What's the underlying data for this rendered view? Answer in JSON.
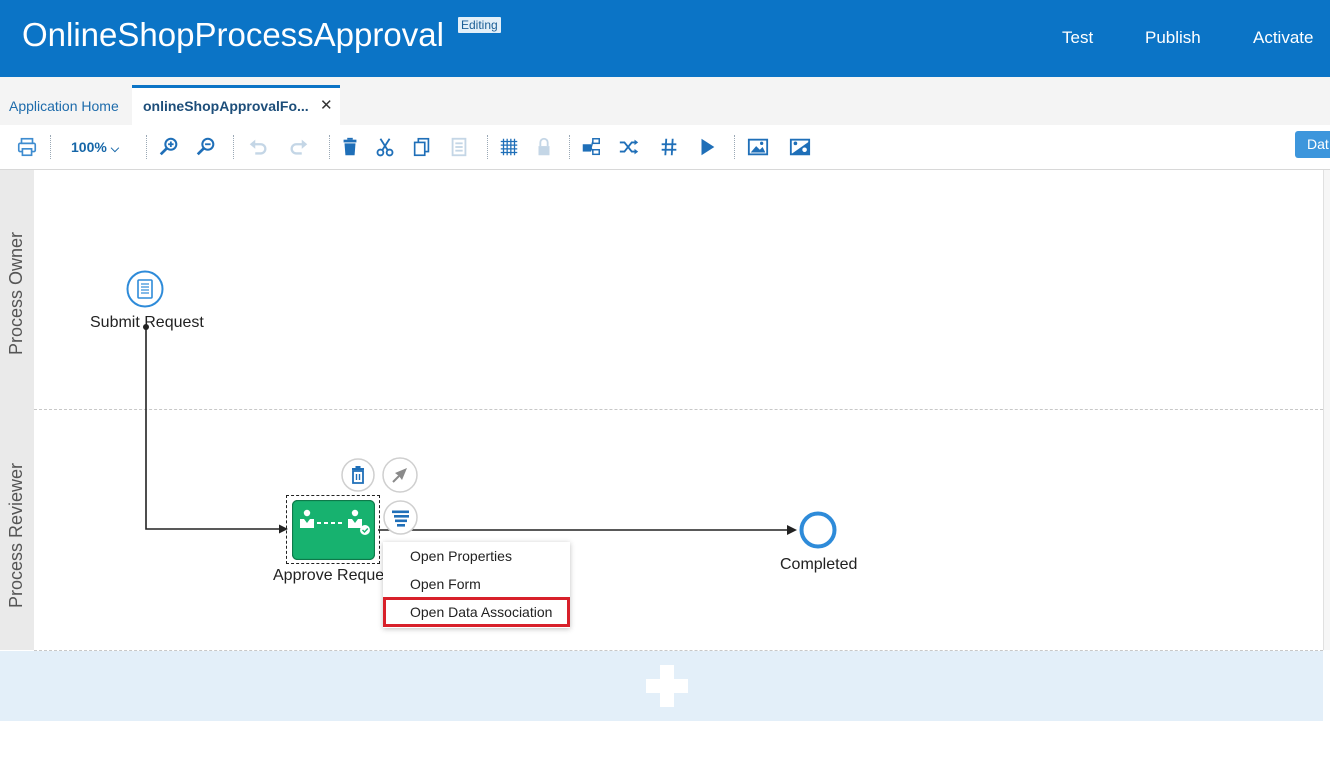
{
  "header": {
    "app_title": "OnlineShopProcessApproval",
    "status_badge": "Editing",
    "actions": {
      "test": "Test",
      "publish": "Publish",
      "activate": "Activate"
    }
  },
  "tabs": [
    {
      "label": "Application Home"
    },
    {
      "label": "onlineShopApprovalFo...",
      "close": "✕"
    }
  ],
  "toolbar": {
    "zoom_level": "100%",
    "data_button_label": "Dat",
    "icons": [
      "print-icon",
      "zoom-in-icon",
      "zoom-out-icon",
      "undo-icon",
      "redo-icon",
      "delete-icon",
      "cut-icon",
      "copy-icon",
      "paste-icon",
      "grid-icon",
      "lock-icon",
      "validate-icon",
      "shuffle-icon",
      "hash-icon",
      "play-icon",
      "image-icon",
      "image-settings-icon"
    ]
  },
  "swimlanes": [
    {
      "label": "Process Owner"
    },
    {
      "label": "Process Reviewer"
    }
  ],
  "nodes": {
    "start": {
      "label": "Submit Request"
    },
    "task": {
      "label": "Approve Request"
    },
    "end": {
      "label": "Completed"
    }
  },
  "context_menu": {
    "items": [
      {
        "label": "Open Properties"
      },
      {
        "label": "Open Form"
      },
      {
        "label": "Open Data Association"
      }
    ],
    "highlighted_item": "Open Data Association"
  },
  "colors": {
    "header_bg": "#0B74C6",
    "task_green": "#17B26F",
    "end_event_blue": "#2E8BD9",
    "highlight_red": "#D8202A"
  }
}
